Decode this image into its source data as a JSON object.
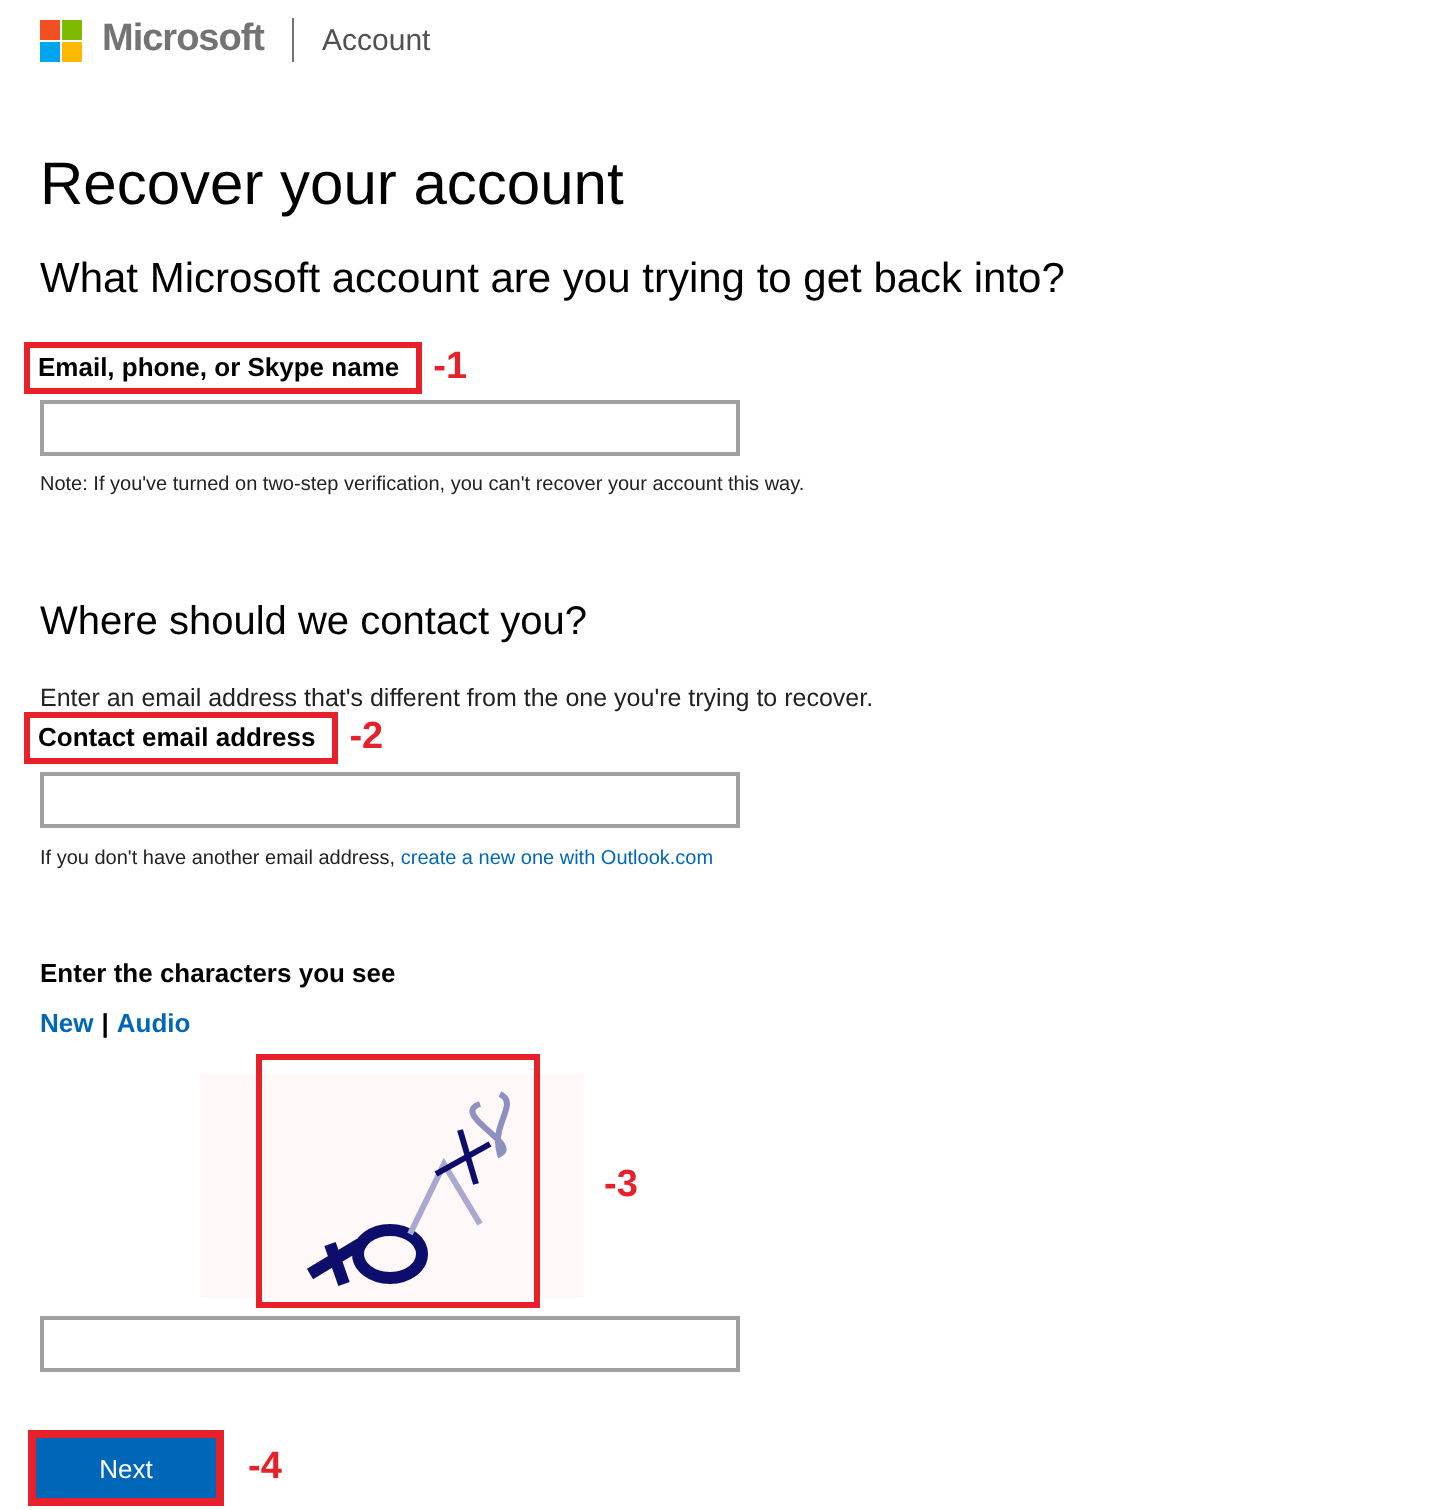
{
  "header": {
    "brand": "Microsoft",
    "section": "Account"
  },
  "title": "Recover your account",
  "account_section": {
    "heading": "What Microsoft account are you trying to get back into?",
    "field_label": "Email, phone, or Skype name",
    "annotation": "-1",
    "note": "Note: If you've turned on two-step verification, you can't recover your account this way."
  },
  "contact_section": {
    "heading": "Where should we contact you?",
    "intro": "Enter an email address that's different from the one you're trying to recover.",
    "field_label": "Contact email address",
    "annotation": "-2",
    "helper": "If you don't have another email address,",
    "helper_link": "create a new one with Outlook.com"
  },
  "captcha": {
    "heading": "Enter the characters you see",
    "new_link": "New",
    "separator": "|",
    "audio_link": "Audio",
    "annotation": "-3"
  },
  "next_button": {
    "label": "Next",
    "annotation": "-4"
  }
}
